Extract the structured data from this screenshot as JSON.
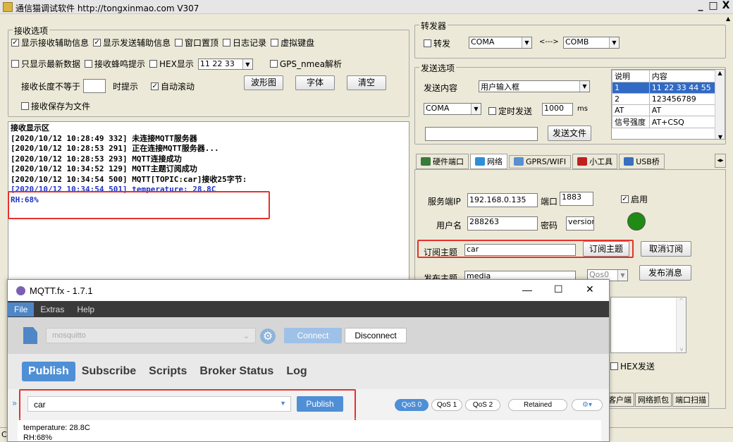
{
  "titlebar": {
    "title": "通信猫调试软件 http://tongxinmao.com V307",
    "min": "_",
    "max": "□",
    "close": "X"
  },
  "recv_options": {
    "title": "接收选项",
    "row1": [
      {
        "label": "显示接收辅助信息",
        "checked": true
      },
      {
        "label": "显示发送辅助信息",
        "checked": true
      },
      {
        "label": "窗口置顶",
        "checked": false
      },
      {
        "label": "日志记录",
        "checked": false
      },
      {
        "label": "虚拟键盘",
        "checked": false
      }
    ],
    "row2": [
      {
        "label": "只显示最新数据",
        "checked": false
      },
      {
        "label": "接收蜂鸣提示",
        "checked": false
      },
      {
        "label": "HEX显示",
        "checked": false
      }
    ],
    "hex_value": "11 22 33",
    "gps_label": "GPS_nmea解析",
    "length_label": "接收长度不等于",
    "length_value": "",
    "prompt_label": "时提示",
    "autoscroll_label": "自动滚动",
    "btn_wave": "波形图",
    "btn_font": "字体",
    "btn_clear": "清空",
    "save_label": "接收保存为文件"
  },
  "recv_area": {
    "title": "接收显示区",
    "lines": [
      {
        "ts": "[2020/10/12 10:28:49 332]",
        "text": "未连接MQTT服务器"
      },
      {
        "ts": "[2020/10/12 10:28:53 291]",
        "text": "正在连接MQTT服务器..."
      },
      {
        "ts": "[2020/10/12 10:28:53 293]",
        "text": "MQTT连接成功"
      },
      {
        "ts": "[2020/10/12 10:34:52 129]",
        "text": "MQTT主题订阅成功"
      },
      {
        "ts": "[2020/10/12 10:34:54 500]",
        "text": "MQTT[TOPIC:car]接收25字节:"
      },
      {
        "ts": "[2020/10/12 10:34:54 501]",
        "text": "temperature: 28.8C"
      }
    ],
    "extra": "RH:68%"
  },
  "forwarder": {
    "title": "转发器",
    "forward_label": "转发",
    "port_a": "COMA",
    "arrow": "<--->",
    "port_b": "COMB"
  },
  "send_options": {
    "title": "发送选项",
    "content_label": "发送内容",
    "content_value": "用户输入框",
    "port": "COMA",
    "timer_label": "定时发送",
    "timer_value": "1000",
    "ms_label": "ms",
    "file_input": "",
    "send_file_btn": "发送文件",
    "table_headers": [
      "说明",
      "内容"
    ],
    "table_rows": [
      [
        "1",
        "11 22 33 44 55"
      ],
      [
        "2",
        "123456789"
      ],
      [
        "AT",
        "AT"
      ],
      [
        "信号强度",
        "AT+CSQ"
      ]
    ]
  },
  "tabs": [
    "硬件端口",
    "网络",
    "GPRS/WIFI",
    "小工具",
    "USB桥"
  ],
  "network": {
    "server_ip_label": "服务端IP",
    "server_ip": "192.168.0.135",
    "port_label": "端口",
    "port": "1883",
    "enable_label": "启用",
    "user_label": "用户名",
    "user": "288263",
    "pwd_label": "密码",
    "pwd": "version",
    "sub_topic_label": "订阅主题",
    "sub_topic": "car",
    "sub_btn": "订阅主题",
    "unsub_btn": "取消订阅",
    "pub_topic_label": "发布主题",
    "pub_topic": "media",
    "qos": "Qos0",
    "pub_btn": "发布消息",
    "hex_send": "HEX发送",
    "bottom_tabs": [
      "客户端",
      "网络抓包",
      "端口扫描"
    ],
    "status_color": "#1f8a14"
  },
  "mqttfx": {
    "title": "MQTT.fx - 1.7.1",
    "menu": [
      "File",
      "Extras",
      "Help"
    ],
    "profile": "mosquitto",
    "connect": "Connect",
    "disconnect": "Disconnect",
    "tabs": [
      "Publish",
      "Subscribe",
      "Scripts",
      "Broker Status",
      "Log"
    ],
    "topic": "car",
    "publish_btn": "Publish",
    "qos": [
      "QoS 0",
      "QoS 1",
      "QoS 2"
    ],
    "retained": "Retained",
    "message": [
      "temperature: 28.8C",
      "RH:68%"
    ],
    "win_min": "—",
    "win_max": "☐",
    "win_close": "✕"
  },
  "statusbar": {
    "left": "CO"
  }
}
